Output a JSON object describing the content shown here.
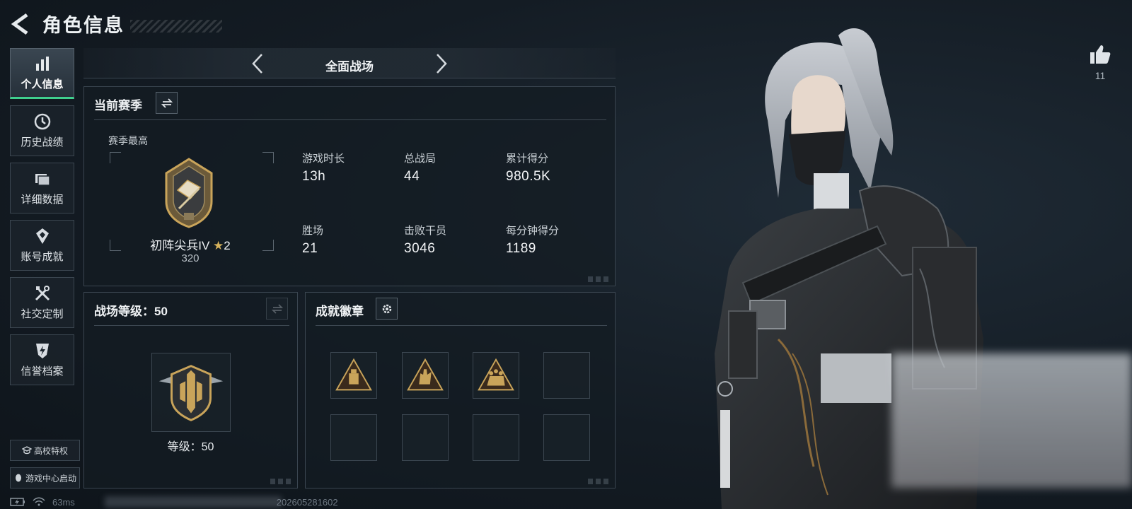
{
  "header": {
    "title": "角色信息"
  },
  "sidebar": {
    "items": [
      {
        "label": "个人信息",
        "icon": "bar-chart-icon",
        "active": true
      },
      {
        "label": "历史战绩",
        "icon": "history-clock-icon",
        "active": false
      },
      {
        "label": "详细数据",
        "icon": "folder-icon",
        "active": false
      },
      {
        "label": "账号成就",
        "icon": "achievement-icon",
        "active": false
      },
      {
        "label": "社交定制",
        "icon": "tools-icon",
        "active": false
      },
      {
        "label": "信誉档案",
        "icon": "shield-bolt-icon",
        "active": false
      }
    ],
    "college_label": "高校特权",
    "gamecenter_label": "游戏中心启动"
  },
  "mode": {
    "title": "全面战场"
  },
  "season": {
    "title": "当前赛季",
    "best_label": "赛季最高",
    "rank_name": "初阵尖兵IV",
    "rank_stars": "2",
    "rank_points": "320",
    "stats": [
      {
        "label": "游戏时长",
        "value": "13h"
      },
      {
        "label": "总战局",
        "value": "44"
      },
      {
        "label": "累计得分",
        "value": "980.5K"
      },
      {
        "label": "胜场",
        "value": "21"
      },
      {
        "label": "击败干员",
        "value": "3046"
      },
      {
        "label": "每分钟得分",
        "value": "1189"
      }
    ]
  },
  "battle_level": {
    "title": "战场等级：50",
    "level_text": "等级：50"
  },
  "badges": {
    "title": "成就徽章"
  },
  "status": {
    "ping": "63ms",
    "build": "202605281602"
  },
  "likes": {
    "count": "11"
  },
  "colors": {
    "accent": "#3fcf8e",
    "gold": "#c9a45a"
  }
}
